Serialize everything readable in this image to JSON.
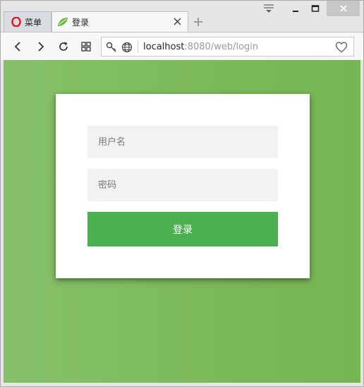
{
  "browser": {
    "menu_tab_label": "菜单",
    "active_tab_title": "登录",
    "url_host": "localhost",
    "url_rest": ":8080/web/login"
  },
  "login": {
    "username_placeholder": "用户名",
    "password_placeholder": "密码",
    "submit_label": "登录"
  },
  "colors": {
    "page_background": "#7cb95a",
    "button_green": "#4caf50",
    "opera_red": "#e0181c",
    "spring_leaf": "#6db33f"
  },
  "icons": {
    "menu": "opera-logo-icon",
    "tab": "spring-leaf-icon",
    "close": "close-icon",
    "new_tab": "plus-icon",
    "back": "back-arrow-icon",
    "forward": "forward-arrow-icon",
    "reload": "reload-icon",
    "speed_dial": "speed-dial-icon",
    "security": "key-icon",
    "site_info": "globe-icon",
    "bookmark": "heart-icon"
  }
}
